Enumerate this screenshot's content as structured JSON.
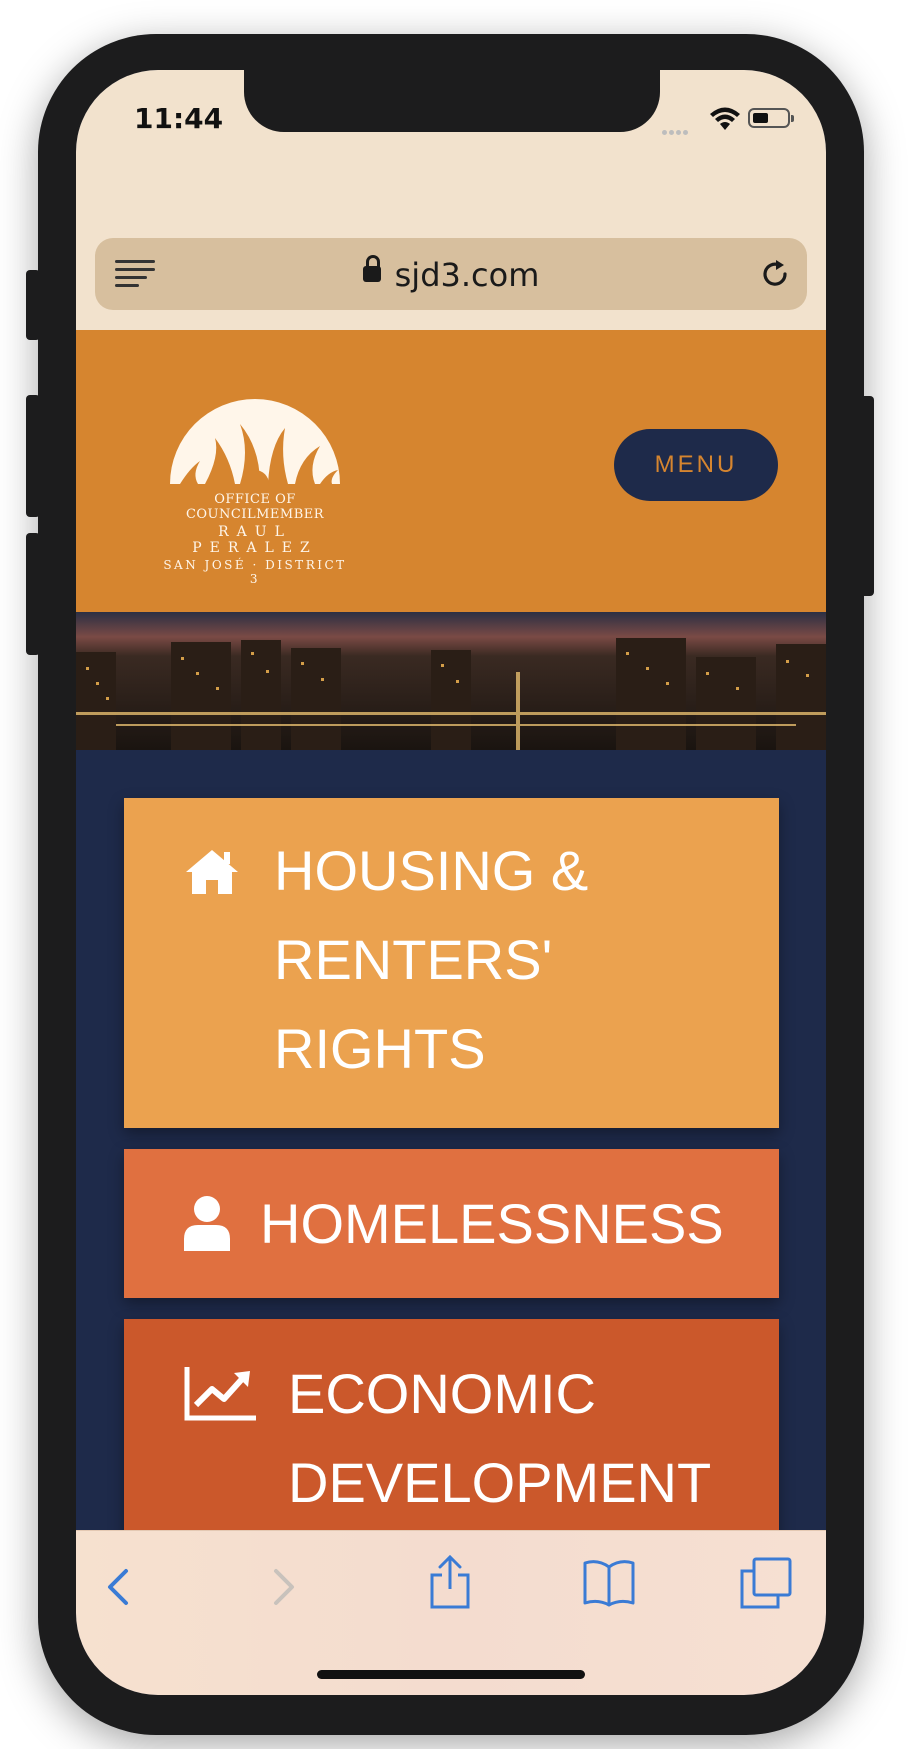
{
  "status_bar": {
    "time": "11:44"
  },
  "browser": {
    "url": "sjd3.com"
  },
  "header": {
    "logo": {
      "line1": "OFFICE OF COUNCILMEMBER",
      "line2": "RAUL PERALEZ",
      "line3": "SAN JOSÉ · DISTRICT 3"
    },
    "menu_label": "MENU"
  },
  "cards": [
    {
      "icon": "home-icon",
      "label_lines": [
        "HOUSING &",
        "RENTERS'",
        "RIGHTS"
      ],
      "color": "#eba24f"
    },
    {
      "icon": "user-icon",
      "label_lines": [
        "HOMELESSNESS"
      ],
      "color": "#e07040"
    },
    {
      "icon": "line-chart-icon",
      "label_lines": [
        "ECONOMIC",
        "DEVELOPMENT"
      ],
      "color": "#cb582b"
    },
    {
      "icon": "",
      "label_lines": [],
      "color": "#cd6a2b"
    }
  ],
  "colors": {
    "header_bg": "#d6852f",
    "navy": "#1e2a4a",
    "browser_chrome": "#f2e2cd",
    "url_bar": "#d7bf9e",
    "toolbar_icon": "#3a7bd5"
  },
  "toolbar": {
    "icons": [
      "back-icon",
      "forward-icon",
      "share-icon",
      "bookmarks-icon",
      "tabs-icon"
    ]
  }
}
